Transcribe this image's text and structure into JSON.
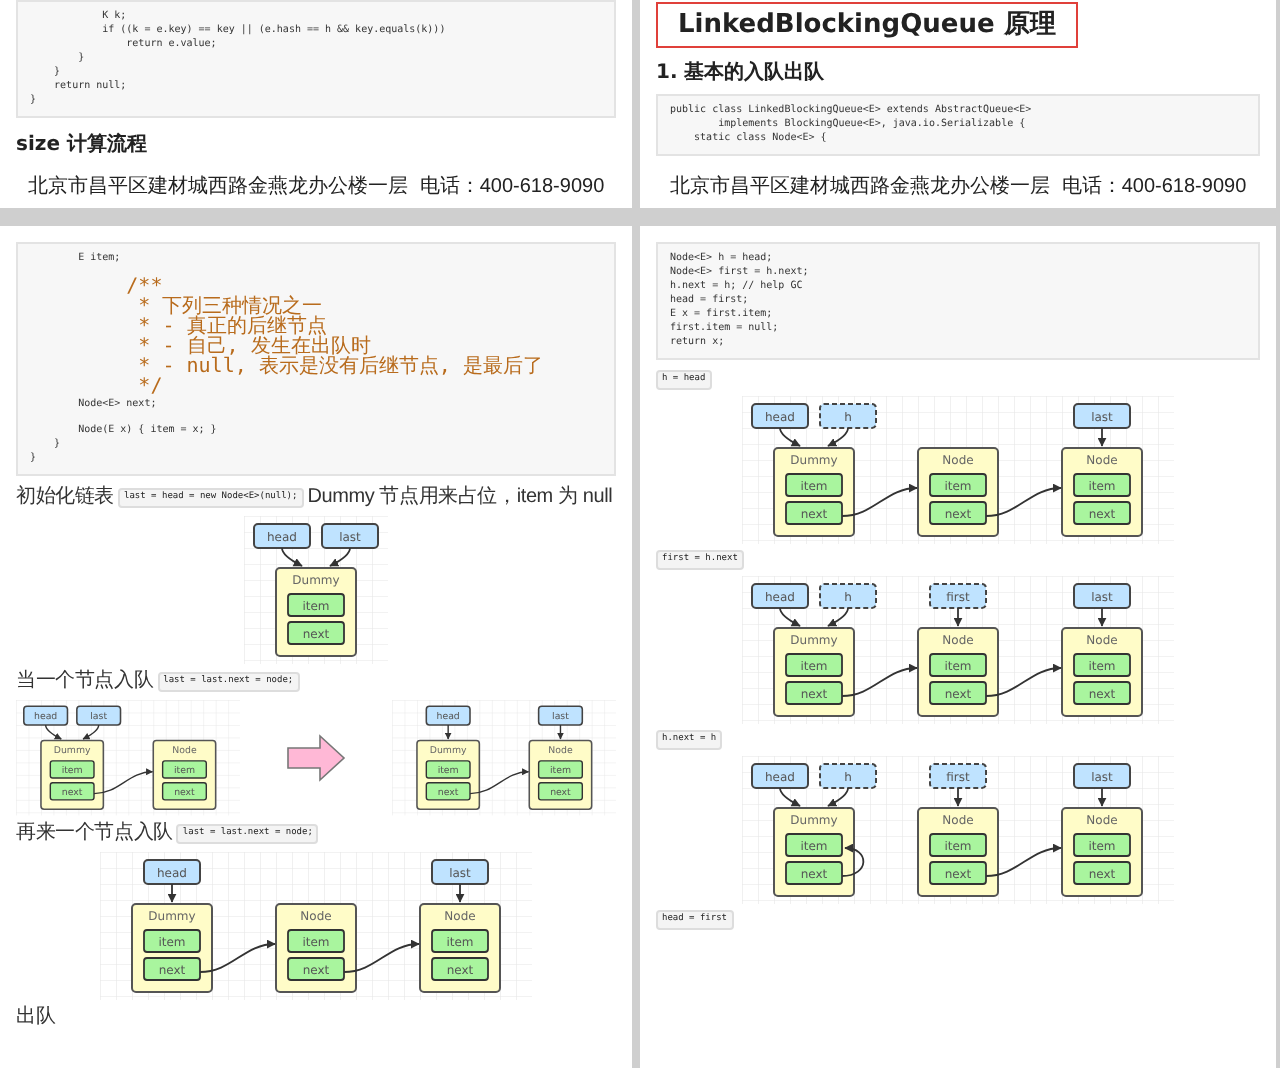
{
  "pages": [
    {
      "blocks": [
        {
          "kind": "code",
          "lines": [
            {
              "kind": "code",
              "text": "            K k;"
            },
            {
              "kind": "code",
              "text": "            if ((k = e.key) == key || (e.hash == h && key.equals(k)))"
            },
            {
              "kind": "code",
              "text": "                return e.value;"
            },
            {
              "kind": "code",
              "text": "        }"
            },
            {
              "kind": "code",
              "text": "    }"
            },
            {
              "kind": "code",
              "text": "    return null;"
            },
            {
              "kind": "code",
              "text": "}"
            }
          ]
        },
        {
          "kind": "heading",
          "text": "size 计算流程"
        },
        {
          "kind": "footer",
          "address": "北京市昌平区建材城西路金燕龙办公楼一层",
          "phone": "电话：400-618-9090"
        }
      ]
    },
    {
      "blocks": [
        {
          "kind": "title",
          "text": "LinkedBlockingQueue 原理",
          "boxed": true
        },
        {
          "kind": "heading",
          "text": "1. 基本的入队出队"
        },
        {
          "kind": "code",
          "lines": [
            {
              "kind": "code",
              "text": "public class LinkedBlockingQueue<E> extends AbstractQueue<E>"
            },
            {
              "kind": "code",
              "text": "        implements BlockingQueue<E>, java.io.Serializable {"
            },
            {
              "kind": "code",
              "text": "    static class Node<E> {"
            }
          ]
        },
        {
          "kind": "footer",
          "address": "北京市昌平区建材城西路金燕龙办公楼一层",
          "phone": "电话：400-618-9090"
        }
      ]
    },
    {
      "blocks": [
        {
          "kind": "code",
          "lines": [
            {
              "kind": "code",
              "text": "        E item;"
            },
            {
              "kind": "blank"
            },
            {
              "kind": "comment",
              "text": "        /**"
            },
            {
              "kind": "comment",
              "text": "         * 下列三种情况之一"
            },
            {
              "kind": "comment",
              "text": "         * - 真正的后继节点"
            },
            {
              "kind": "comment",
              "text": "         * - 自己, 发生在出队时"
            },
            {
              "kind": "comment",
              "text": "         * - null, 表示是没有后继节点, 是最后了"
            },
            {
              "kind": "comment",
              "text": "         */"
            },
            {
              "kind": "code",
              "text": "        Node<E> next;"
            },
            {
              "kind": "blank"
            },
            {
              "kind": "code",
              "text": "        Node(E x) { item = x; }"
            },
            {
              "kind": "code",
              "text": "    }"
            },
            {
              "kind": "code",
              "text": "}"
            }
          ]
        },
        {
          "kind": "paragraph",
          "parts": [
            {
              "kind": "text",
              "text": "初始化链表"
            },
            {
              "kind": "code",
              "text": "last = head = new Node<E>(null);"
            },
            {
              "kind": "text",
              "text": "Dummy 节点用来占位，item 为 null"
            }
          ]
        },
        {
          "kind": "diagram",
          "nodes": [
            {
              "kind": "last",
              "title": "Dummy",
              "fields": [
                "item",
                "next"
              ],
              "pointers": [
                {
                  "label": "head",
                  "dashed": false
                },
                {
                  "label": "last",
                  "dashed": false
                }
              ]
            }
          ]
        },
        {
          "kind": "paragraph",
          "parts": [
            {
              "kind": "text",
              "text": "当一个节点入队"
            },
            {
              "kind": "code",
              "text": "last = last.next = node;"
            }
          ]
        },
        {
          "kind": "pair",
          "before": {
            "nodes": [
              {
                "kind": "linked",
                "title": "Dummy",
                "fields": [
                  "item",
                  "next"
                ],
                "pointers": [
                  {
                    "label": "head",
                    "dashed": false
                  },
                  {
                    "label": "last",
                    "dashed": false
                  }
                ]
              },
              {
                "kind": "last",
                "title": "Node",
                "fields": [
                  "item",
                  "next"
                ]
              }
            ]
          },
          "after": {
            "nodes": [
              {
                "kind": "linked",
                "title": "Dummy",
                "fields": [
                  "item",
                  "next"
                ],
                "pointers": [
                  {
                    "label": "head",
                    "dashed": false
                  }
                ]
              },
              {
                "kind": "last",
                "title": "Node",
                "fields": [
                  "item",
                  "next"
                ],
                "pointers": [
                  {
                    "label": "last",
                    "dashed": false
                  }
                ]
              }
            ]
          }
        },
        {
          "kind": "paragraph",
          "parts": [
            {
              "kind": "text",
              "text": "再来一个节点入队"
            },
            {
              "kind": "code",
              "text": "last = last.next = node;"
            }
          ]
        },
        {
          "kind": "diagram",
          "nodes": [
            {
              "kind": "linked",
              "title": "Dummy",
              "fields": [
                "item",
                "next"
              ],
              "pointers": [
                {
                  "label": "head",
                  "dashed": false
                }
              ]
            },
            {
              "kind": "linked",
              "title": "Node",
              "fields": [
                "item",
                "next"
              ]
            },
            {
              "kind": "last",
              "title": "Node",
              "fields": [
                "item",
                "next"
              ],
              "pointers": [
                {
                  "label": "last",
                  "dashed": false
                }
              ]
            }
          ]
        },
        {
          "kind": "paragraph",
          "parts": [
            {
              "kind": "text",
              "text": "出队"
            }
          ]
        }
      ]
    },
    {
      "blocks": [
        {
          "kind": "code",
          "lines": [
            {
              "kind": "code",
              "text": "Node<E> h = head;"
            },
            {
              "kind": "code",
              "text": "Node<E> first = h.next;"
            },
            {
              "kind": "code",
              "text": "h.next = h; // help GC"
            },
            {
              "kind": "code",
              "text": "head = first;"
            },
            {
              "kind": "code",
              "text": "E x = first.item;"
            },
            {
              "kind": "code",
              "text": "first.item = null;"
            },
            {
              "kind": "code",
              "text": "return x;"
            }
          ]
        },
        {
          "kind": "paragraph",
          "parts": [
            {
              "kind": "code",
              "text": "h = head"
            }
          ]
        },
        {
          "kind": "diagram",
          "nodes": [
            {
              "kind": "linked",
              "title": "Dummy",
              "fields": [
                "item",
                "next"
              ],
              "pointers": [
                {
                  "label": "head",
                  "dashed": false
                },
                {
                  "label": "h",
                  "dashed": true
                }
              ]
            },
            {
              "kind": "linked",
              "title": "Node",
              "fields": [
                "item",
                "next"
              ]
            },
            {
              "kind": "last",
              "title": "Node",
              "fields": [
                "item",
                "next"
              ],
              "pointers": [
                {
                  "label": "last",
                  "dashed": false
                }
              ]
            }
          ]
        },
        {
          "kind": "paragraph",
          "parts": [
            {
              "kind": "code",
              "text": "first = h.next"
            }
          ]
        },
        {
          "kind": "diagram",
          "nodes": [
            {
              "kind": "linked",
              "title": "Dummy",
              "fields": [
                "item",
                "next"
              ],
              "pointers": [
                {
                  "label": "head",
                  "dashed": false
                },
                {
                  "label": "h",
                  "dashed": true
                }
              ]
            },
            {
              "kind": "linked",
              "title": "Node",
              "fields": [
                "item",
                "next"
              ],
              "pointers": [
                {
                  "label": "first",
                  "dashed": true
                }
              ]
            },
            {
              "kind": "last",
              "title": "Node",
              "fields": [
                "item",
                "next"
              ],
              "pointers": [
                {
                  "label": "last",
                  "dashed": false
                }
              ]
            }
          ]
        },
        {
          "kind": "paragraph",
          "parts": [
            {
              "kind": "code",
              "text": "h.next = h"
            }
          ]
        },
        {
          "kind": "diagram",
          "nodes": [
            {
              "kind": "looped",
              "title": "Dummy",
              "fields": [
                "item",
                "next"
              ],
              "pointers": [
                {
                  "label": "head",
                  "dashed": false
                },
                {
                  "label": "h",
                  "dashed": true
                }
              ]
            },
            {
              "kind": "linked",
              "title": "Node",
              "fields": [
                "item",
                "next"
              ],
              "pointers": [
                {
                  "label": "first",
                  "dashed": true
                }
              ]
            },
            {
              "kind": "last",
              "title": "Node",
              "fields": [
                "item",
                "next"
              ],
              "pointers": [
                {
                  "label": "last",
                  "dashed": false
                }
              ]
            }
          ]
        },
        {
          "kind": "paragraph",
          "parts": [
            {
              "kind": "code",
              "text": "head = first"
            }
          ]
        }
      ]
    }
  ]
}
